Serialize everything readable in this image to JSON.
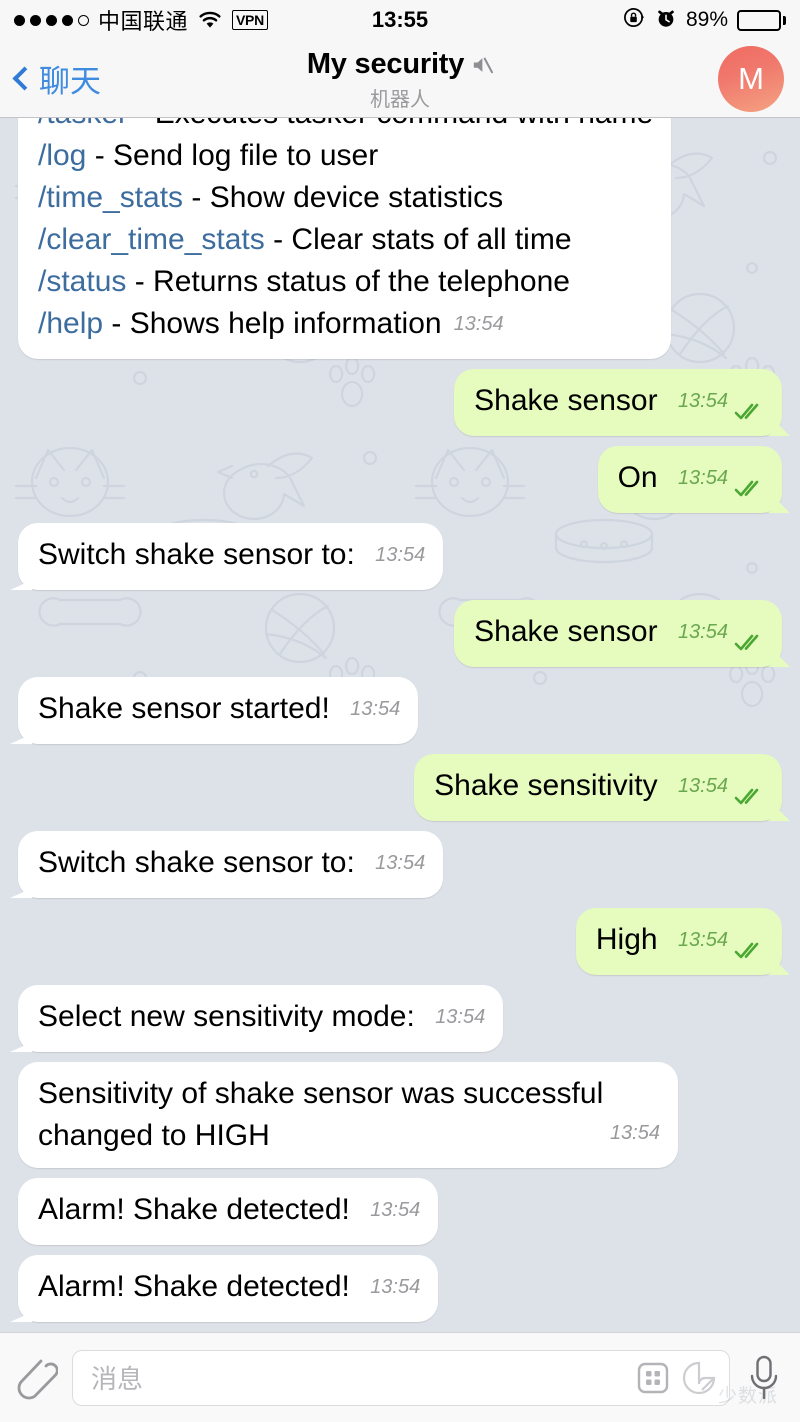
{
  "status_bar": {
    "signal_dots_filled": 4,
    "signal_dots_total": 5,
    "carrier": "中国联通",
    "wifi_icon": "wifi-icon",
    "vpn_label": "VPN",
    "time": "13:55",
    "rotation_lock_icon": "rotation-lock-icon",
    "alarm_icon": "alarm-clock-icon",
    "battery_percent": "89%",
    "battery_level": 89
  },
  "header": {
    "back_icon": "chevron-left-icon",
    "back_label": "聊天",
    "title": "My security",
    "mute_icon": "speaker-muted-icon",
    "subtitle": "机器人",
    "avatar_initial": "M",
    "avatar_color_top": "#ef6b62",
    "avatar_color_bottom": "#f4a383"
  },
  "theme": {
    "chat_background": "#dde2e8",
    "incoming_bubble": "#ffffff",
    "outgoing_bubble": "#e6fbbe",
    "link_color": "#3c6d9e",
    "outgoing_meta_color": "#6aa84f",
    "incoming_meta_color": "#9a9a9e",
    "accent_blue": "#3f8be0"
  },
  "messages": [
    {
      "id": "help-commands",
      "direction": "in",
      "clipped_top": true,
      "tail": false,
      "time": "13:54",
      "status": "",
      "lines": [
        [
          {
            "t": "/tasker",
            "link": true
          },
          {
            "t": " - Executes tasker command with name",
            "link": false
          }
        ],
        [
          {
            "t": "/log",
            "link": true
          },
          {
            "t": " - Send log file to user",
            "link": false
          }
        ],
        [
          {
            "t": "/time_stats",
            "link": true
          },
          {
            "t": " - Show device statistics",
            "link": false
          }
        ],
        [
          {
            "t": "/clear_time_stats",
            "link": true
          },
          {
            "t": " - Clear stats of all time",
            "link": false
          }
        ],
        [
          {
            "t": "/status",
            "link": true
          },
          {
            "t": " - Returns status of the telephone",
            "link": false
          }
        ],
        [
          {
            "t": "/help",
            "link": true
          },
          {
            "t": " - Shows help information",
            "link": false
          }
        ]
      ]
    },
    {
      "id": "msg-shake-sensor-1",
      "direction": "out",
      "tail": true,
      "time": "13:54",
      "status": "read",
      "text": "Shake sensor"
    },
    {
      "id": "msg-on",
      "direction": "out",
      "tail": true,
      "time": "13:54",
      "status": "read",
      "text": "On"
    },
    {
      "id": "msg-switch-shake-1",
      "direction": "in",
      "tail": true,
      "time": "13:54",
      "status": "",
      "text": "Switch shake sensor to:"
    },
    {
      "id": "msg-shake-sensor-2",
      "direction": "out",
      "tail": true,
      "time": "13:54",
      "status": "read",
      "text": "Shake sensor"
    },
    {
      "id": "msg-shake-started",
      "direction": "in",
      "tail": true,
      "time": "13:54",
      "status": "",
      "text": "Shake sensor started!"
    },
    {
      "id": "msg-shake-sensitivity",
      "direction": "out",
      "tail": true,
      "time": "13:54",
      "status": "read",
      "text": "Shake sensitivity"
    },
    {
      "id": "msg-switch-shake-2",
      "direction": "in",
      "tail": true,
      "time": "13:54",
      "status": "",
      "text": "Switch shake sensor to:"
    },
    {
      "id": "msg-high",
      "direction": "out",
      "tail": true,
      "time": "13:54",
      "status": "read",
      "text": "High"
    },
    {
      "id": "msg-select-sensitivity",
      "direction": "in",
      "tail": true,
      "time": "13:54",
      "status": "",
      "text": "Select new sensitivity mode:"
    },
    {
      "id": "msg-sensitivity-changed",
      "direction": "in",
      "tail": false,
      "multiline": true,
      "time": "13:54",
      "status": "",
      "text": "Sensitivity of shake sensor was successful changed to HIGH"
    },
    {
      "id": "msg-alarm-1",
      "direction": "in",
      "tail": false,
      "time": "13:54",
      "status": "",
      "text": "Alarm! Shake detected!"
    },
    {
      "id": "msg-alarm-2",
      "direction": "in",
      "tail": true,
      "time": "13:54",
      "status": "",
      "text": "Alarm! Shake detected!"
    }
  ],
  "input_bar": {
    "attach_icon": "paperclip-icon",
    "placeholder": "消息",
    "value": "",
    "keyboard_icon": "grid-keyboard-icon",
    "sticker_icon": "sticker-icon",
    "mic_icon": "microphone-icon",
    "watermark": "少数派"
  }
}
